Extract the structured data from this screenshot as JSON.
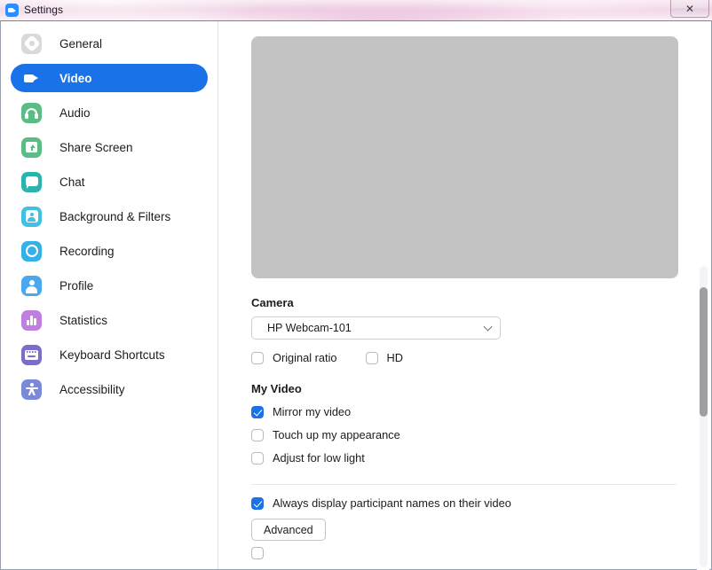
{
  "window": {
    "title": "Settings",
    "app_icon": "zoom-camera-icon",
    "close_label": "✕"
  },
  "sidebar": {
    "items": [
      {
        "label": "General",
        "icon": "gear-icon",
        "active": false
      },
      {
        "label": "Video",
        "icon": "video-camera-icon",
        "active": true
      },
      {
        "label": "Audio",
        "icon": "headphones-icon",
        "active": false
      },
      {
        "label": "Share Screen",
        "icon": "screen-share-icon",
        "active": false
      },
      {
        "label": "Chat",
        "icon": "chat-bubble-icon",
        "active": false
      },
      {
        "label": "Background & Filters",
        "icon": "person-frame-icon",
        "active": false
      },
      {
        "label": "Recording",
        "icon": "record-ring-icon",
        "active": false
      },
      {
        "label": "Profile",
        "icon": "person-icon",
        "active": false
      },
      {
        "label": "Statistics",
        "icon": "bar-chart-icon",
        "active": false
      },
      {
        "label": "Keyboard Shortcuts",
        "icon": "keyboard-icon",
        "active": false
      },
      {
        "label": "Accessibility",
        "icon": "accessibility-icon",
        "active": false
      }
    ]
  },
  "main": {
    "preview": {
      "state": "no-video"
    },
    "camera": {
      "heading": "Camera",
      "selected": "HP Webcam-101",
      "options": [
        "HP Webcam-101"
      ],
      "original_ratio": {
        "label": "Original ratio",
        "checked": false
      },
      "hd": {
        "label": "HD",
        "checked": false
      }
    },
    "my_video": {
      "heading": "My Video",
      "options": [
        {
          "label": "Mirror my video",
          "checked": true
        },
        {
          "label": "Touch up my appearance",
          "checked": false
        },
        {
          "label": "Adjust for low light",
          "checked": false
        }
      ]
    },
    "meetings": {
      "options": [
        {
          "label": "Always display participant names on their video",
          "checked": true
        }
      ]
    },
    "advanced_button": "Advanced"
  },
  "colors": {
    "accent": "#1a72e8",
    "titlebar": "#f0cfe3",
    "preview_bg": "#c3c3c3",
    "scroll_thumb": "#9e9ea3"
  }
}
